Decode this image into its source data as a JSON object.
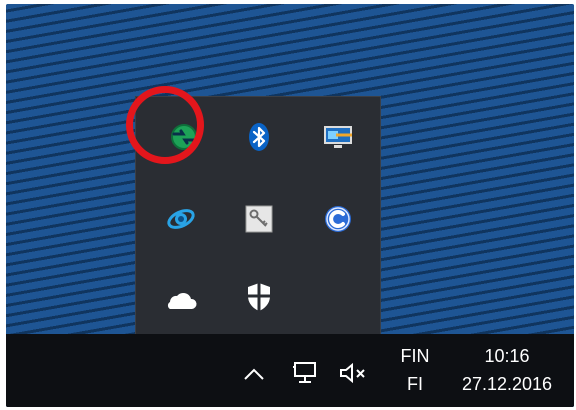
{
  "tray_popup": {
    "icons": [
      {
        "name": "network-sync-icon",
        "color": "#1da257"
      },
      {
        "name": "bluetooth-icon",
        "color": "#ffffff"
      },
      {
        "name": "monitor-settings-icon",
        "color": "#3d8fd6"
      },
      {
        "name": "ie-icon",
        "color": "#29a3e6"
      },
      {
        "name": "key-icon",
        "color": "#cfcfcf"
      },
      {
        "name": "refresh-c-icon",
        "color": "#2b6bd6"
      },
      {
        "name": "onedrive-icon",
        "color": "#ffffff"
      },
      {
        "name": "defender-shield-icon",
        "color": "#ffffff"
      }
    ],
    "highlight_color": "#e3161c"
  },
  "taskbar": {
    "language_code": "FIN",
    "keyboard_layout": "FI",
    "time": "10:16",
    "date": "27.12.2016",
    "icons": [
      "chevron-up-icon",
      "network-icon",
      "volume-muted-icon"
    ]
  }
}
